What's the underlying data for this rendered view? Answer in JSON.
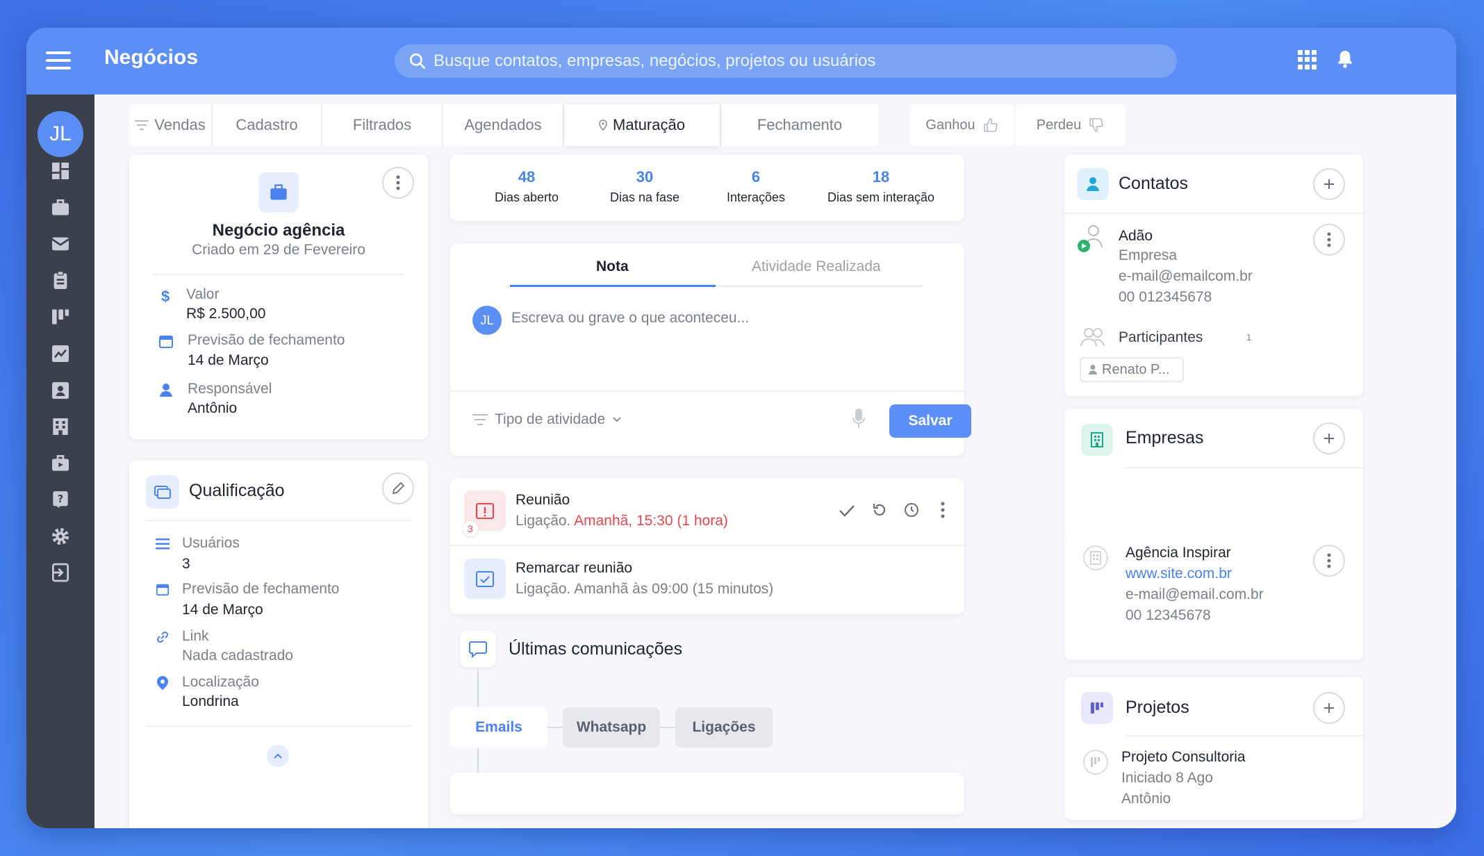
{
  "header": {
    "title": "Negócios",
    "search_placeholder": "Busque contatos, empresas, negócios, projetos ou usuários"
  },
  "user": {
    "initials": "JL"
  },
  "pipeline": {
    "stages": [
      "Vendas",
      "Cadastro",
      "Filtrados",
      "Agendados",
      "Maturação",
      "Fechamento"
    ],
    "active_stage": "Maturação",
    "won_label": "Ganhou",
    "lost_label": "Perdeu"
  },
  "deal": {
    "name": "Negócio agência",
    "created": "Criado em 29 de Fevereiro",
    "value_label": "Valor",
    "value": "R$ 2.500,00",
    "close_label": "Previsão de fechamento",
    "close_date": "14 de Março",
    "owner_label": "Responsável",
    "owner": "Antônio"
  },
  "qualification": {
    "title": "Qualificação",
    "users_label": "Usuários",
    "users": "3",
    "close_label": "Previsão de fechamento",
    "close_date": "14 de Março",
    "link_label": "Link",
    "link": "Nada cadastrado",
    "location_label": "Localização",
    "location": "Londrina"
  },
  "stats": [
    {
      "value": "48",
      "label": "Dias aberto"
    },
    {
      "value": "30",
      "label": "Dias na fase"
    },
    {
      "value": "6",
      "label": "Interações"
    },
    {
      "value": "18",
      "label": "Dias sem interação"
    }
  ],
  "note": {
    "tab_note": "Nota",
    "tab_activity": "Atividade Realizada",
    "placeholder": "Escreva ou grave o que aconteceu...",
    "activity_type": "Tipo de atividade",
    "save": "Salvar"
  },
  "activities": [
    {
      "title": "Reunião",
      "type": "Ligação.",
      "when": "Amanhã, 15:30",
      "duration": "(1 hora)",
      "badge": "3"
    },
    {
      "title": "Remarcar reunião",
      "type": "Ligação.",
      "when": "Amanhã às 09:00",
      "duration": "(15 minutos)"
    }
  ],
  "communications": {
    "title": "Últimas comunicações",
    "tabs": [
      "Emails",
      "Whatsapp",
      "Ligações"
    ]
  },
  "contacts": {
    "title": "Contatos",
    "name": "Adão",
    "company": "Empresa",
    "email": "e-mail@emailcom.br",
    "phone": "00 012345678",
    "participants_label": "Participantes",
    "participants_count": "1",
    "participant": "Renato P..."
  },
  "companies": {
    "title": "Empresas",
    "name": "Agência Inspirar",
    "site": "www.site.com.br",
    "email": "e-mail@email.com.br",
    "phone": "00 12345678"
  },
  "projects": {
    "title": "Projetos",
    "name": "Projeto Consultoria",
    "started": "Iniciado 8 Ago",
    "owner": "Antônio"
  },
  "colors": {
    "brand": "#5b8ff5",
    "sidebar": "#3a404c",
    "danger": "#e6484f"
  }
}
